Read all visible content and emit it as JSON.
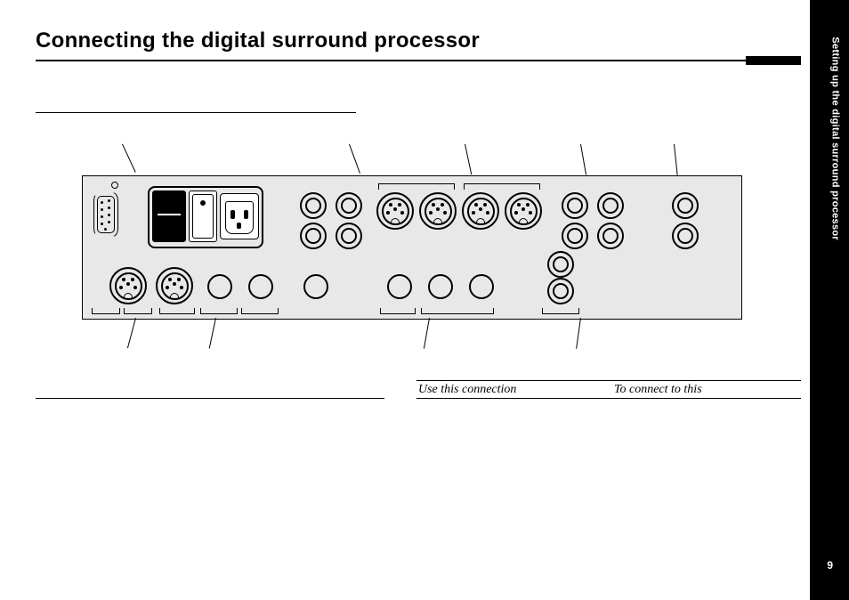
{
  "title": "Connecting the digital surround processor",
  "sidebar": {
    "section_label": "Setting up the digital surround processor",
    "page_number": "9"
  },
  "table_headers": {
    "use_this": "Use this connection",
    "to_connect": "To connect to this"
  }
}
